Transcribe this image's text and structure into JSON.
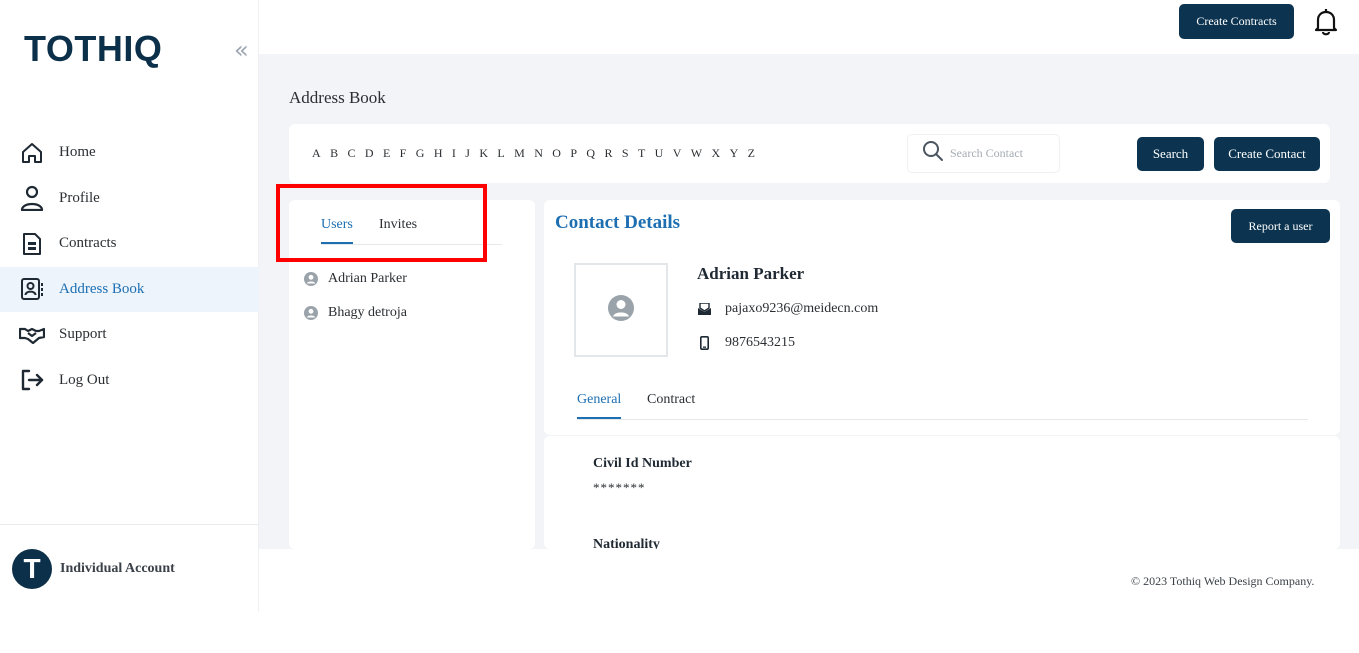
{
  "brand": {
    "logo_text": "TOTHIQ",
    "collapse_icon": "double-chevron-left-icon"
  },
  "sidebar": {
    "items": [
      {
        "label": "Home",
        "icon": "home-icon"
      },
      {
        "label": "Profile",
        "icon": "user-icon"
      },
      {
        "label": "Contracts",
        "icon": "document-icon"
      },
      {
        "label": "Address Book",
        "icon": "address-book-icon",
        "active": true
      },
      {
        "label": "Support",
        "icon": "handshake-icon"
      },
      {
        "label": "Log Out",
        "icon": "logout-icon"
      }
    ],
    "account": {
      "avatar_letter": "T",
      "name": "Individual Account"
    }
  },
  "topbar": {
    "create_contracts_label": "Create Contracts",
    "bell_icon": "bell-icon"
  },
  "page": {
    "title": "Address Book"
  },
  "alphabet": [
    "A",
    "B",
    "C",
    "D",
    "E",
    "F",
    "G",
    "H",
    "I",
    "J",
    "K",
    "L",
    "M",
    "N",
    "O",
    "P",
    "Q",
    "R",
    "S",
    "T",
    "U",
    "V",
    "W",
    "X",
    "Y",
    "Z"
  ],
  "search": {
    "placeholder": "Search Contact",
    "button_label": "Search",
    "create_contact_label": "Create Contact"
  },
  "users_panel": {
    "tabs": [
      {
        "label": "Users",
        "active": true
      },
      {
        "label": "Invites"
      }
    ],
    "users": [
      {
        "name": "Adrian Parker"
      },
      {
        "name": "Bhagy detroja"
      }
    ]
  },
  "contact": {
    "section_title": "Contact Details",
    "report_label": "Report a user",
    "name": "Adrian Parker",
    "email": "pajaxo9236@meidecn.com",
    "phone": "9876543215",
    "tabs": [
      {
        "label": "General",
        "active": true
      },
      {
        "label": "Contract"
      }
    ],
    "fields": [
      {
        "label": "Civil Id Number",
        "value": "*******"
      },
      {
        "label": "Nationality",
        "value": ""
      }
    ]
  },
  "footer": {
    "copyright": "© 2023 Tothiq Web Design Company."
  },
  "colors": {
    "brand_dark": "#0c3049",
    "accent_blue": "#1d6fb2",
    "active_bg": "#edf4fb",
    "highlight_red": "#ff0000"
  }
}
